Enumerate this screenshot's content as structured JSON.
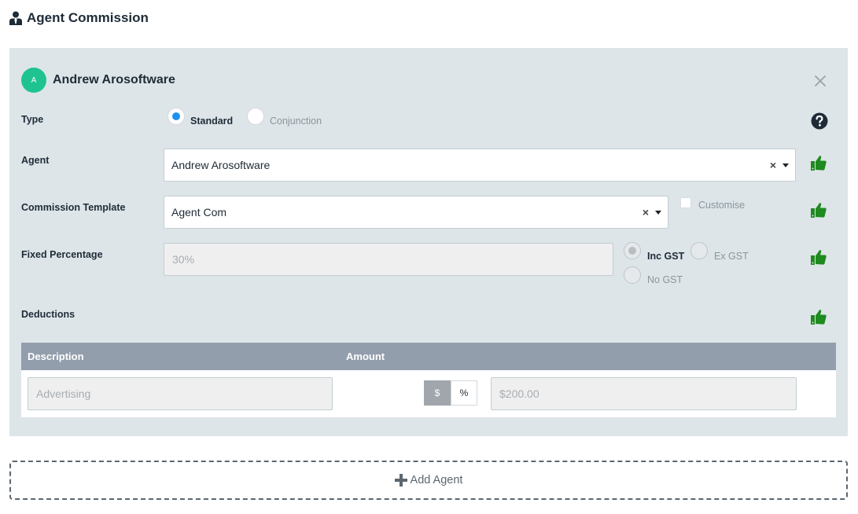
{
  "header": {
    "title": "Agent Commission",
    "icon": "user-tie-icon"
  },
  "agent_card": {
    "avatar_initial": "A",
    "agent_name": "Andrew Arosoftware",
    "type": {
      "label": "Type",
      "options": [
        "Standard",
        "Conjunction"
      ],
      "selected": "Standard"
    },
    "agent_field": {
      "label": "Agent",
      "value": "Andrew Arosoftware",
      "clear": "×"
    },
    "commission_template": {
      "label": "Commission Template",
      "value": "Agent Com",
      "clear": "×",
      "customise_label": "Customise",
      "customise_checked": false
    },
    "fixed_percentage": {
      "label": "Fixed Percentage",
      "placeholder": "30%",
      "gst_options": [
        "Inc GST",
        "Ex GST",
        "No GST"
      ],
      "gst_selected": "Inc GST"
    },
    "deductions": {
      "label": "Deductions",
      "columns": [
        "Description",
        "Amount"
      ],
      "rows": [
        {
          "description_placeholder": "Advertising",
          "unit_options": [
            "$",
            "%"
          ],
          "unit_selected": "$",
          "amount_placeholder": "$200.00"
        }
      ]
    }
  },
  "add_agent_label": "Add Agent",
  "colors": {
    "panel_bg": "#dde5e8",
    "avatar": "#1ec38f",
    "thumb": "#1f8a1f",
    "table_header": "#939eac",
    "radio_selected": "#1e90f0"
  }
}
